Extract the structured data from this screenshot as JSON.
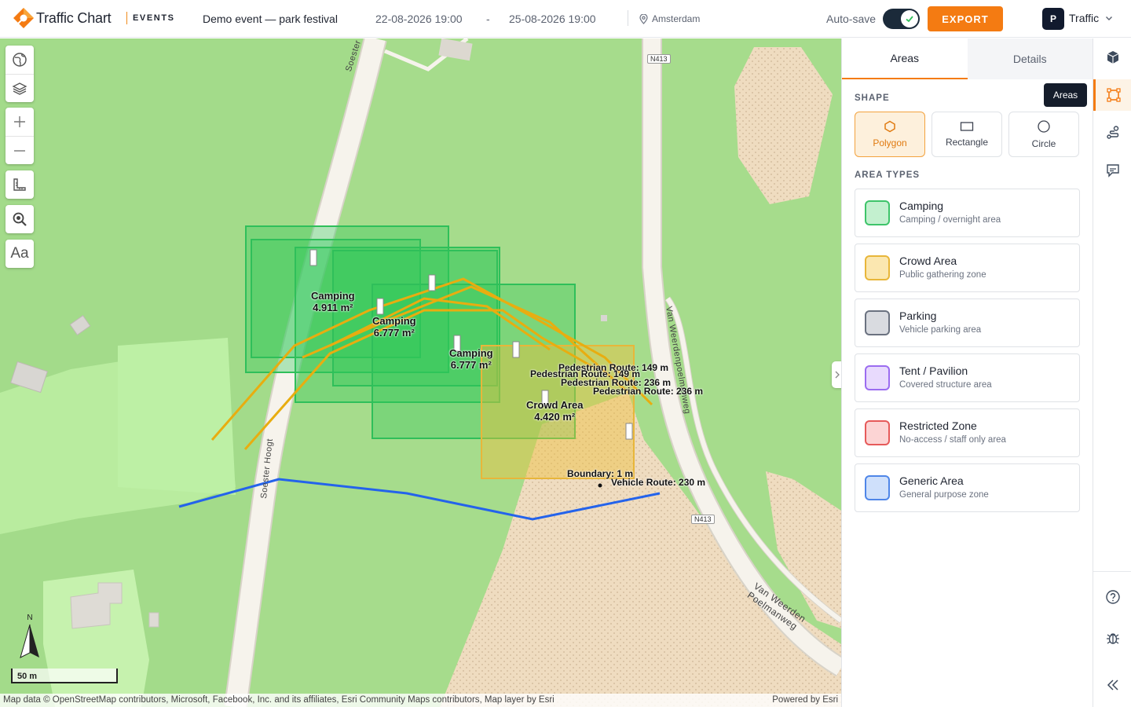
{
  "header": {
    "brand": "Traffic Chart",
    "brand_sub": "EVENTS",
    "event_title": "Demo event — park festival",
    "start_date": "22-08-2026 19:00",
    "date_separator": "-",
    "end_date": "25-08-2026 19:00",
    "location": "Amsterdam",
    "autosave_label": "Auto-save",
    "autosave_on": true,
    "export_label": "EXPORT",
    "avatar_initial": "P",
    "user_menu_label": "Traffic"
  },
  "map": {
    "road_labels": [
      "Soester Hoogt",
      "Soester Hoogt",
      "N413",
      "N413",
      "Van Weerdenpoelmanweg",
      "Van Weerden Poelmanweg"
    ],
    "map_labels": [
      {
        "text": "Camping",
        "sub": "6.777 m²"
      },
      {
        "text": "Camping",
        "sub": "4.911 m²"
      },
      {
        "text": "Camping",
        "sub": "6.777 m²"
      },
      {
        "text": "Crowd Area",
        "sub": "4.420 m²"
      }
    ],
    "measure_labels": [
      "Pedestrian Route: 149 m",
      "Pedestrian Route: 149 m",
      "Pedestrian Route: 236 m",
      "Pedestrian Route: 236 m",
      "Boundary: 1 m",
      "Vehicle Route: 230 m"
    ],
    "north_label": "N",
    "scale_label": "50 m",
    "attribution": "Map data © OpenStreetMap contributors, Microsoft, Facebook, Inc. and its affiliates, Esri Community Maps contributors, Map layer by Esri",
    "powered_by": "Powered by Esri",
    "controls": [
      "globe-icon",
      "layers-icon",
      "zoom-in-icon",
      "zoom-out-icon",
      "ruler-icon",
      "search-zoom-icon",
      "text-icon"
    ],
    "text_tool_label": "Aa"
  },
  "panel": {
    "tabs": [
      {
        "label": "Areas",
        "active": true
      },
      {
        "label": "Details",
        "active": false
      }
    ],
    "shape_heading": "SHAPE",
    "shapes": [
      {
        "label": "Polygon",
        "selected": true
      },
      {
        "label": "Rectangle",
        "selected": false
      },
      {
        "label": "Circle",
        "selected": false
      }
    ],
    "area_types_heading": "AREA TYPES",
    "area_types": [
      {
        "name": "Camping",
        "desc": "Camping / overnight area",
        "fill": "#c3f0cf",
        "stroke": "#3ec46a"
      },
      {
        "name": "Crowd Area",
        "desc": "Public gathering zone",
        "fill": "#fbe7b0",
        "stroke": "#e8b63a"
      },
      {
        "name": "Parking",
        "desc": "Vehicle parking area",
        "fill": "#d9dbe0",
        "stroke": "#6b7280"
      },
      {
        "name": "Tent / Pavilion",
        "desc": "Covered structure area",
        "fill": "#e8dafd",
        "stroke": "#9b6cf0"
      },
      {
        "name": "Restricted Zone",
        "desc": "No-access / staff only area",
        "fill": "#fcd4d4",
        "stroke": "#e65a5a"
      },
      {
        "name": "Generic Area",
        "desc": "General purpose zone",
        "fill": "#cfe0fb",
        "stroke": "#4f86e8"
      }
    ]
  },
  "tooltip": "Areas",
  "rail": [
    "cube-icon",
    "area-icon",
    "route-icon",
    "comment-icon",
    "help-icon",
    "bug-icon",
    "collapse-icon"
  ],
  "colors": {
    "accent": "#f47b12",
    "camping": "#2fbf5a",
    "crowd": "#e8b63a",
    "route_ped": "#e8ad10",
    "route_vehicle": "#2463eb"
  }
}
